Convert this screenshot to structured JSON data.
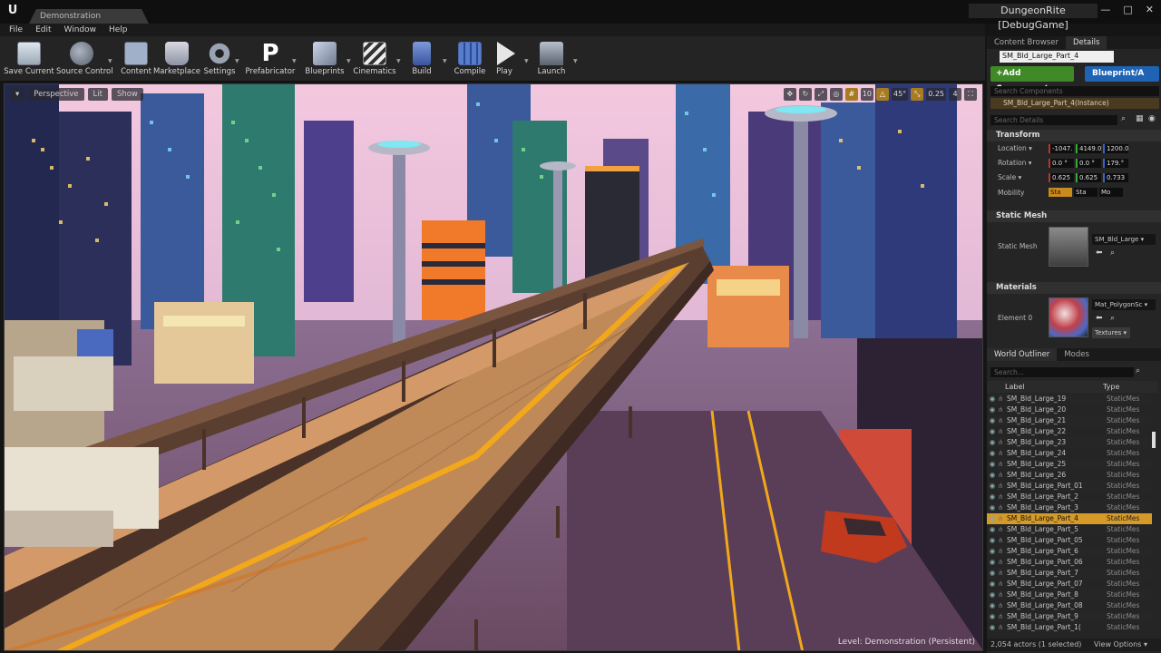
{
  "window": {
    "tab": "Demonstration",
    "project": "DungeonRite [DebugGame]",
    "controls": [
      "—",
      "□",
      "✕"
    ]
  },
  "menu": [
    "File",
    "Edit",
    "Window",
    "Help"
  ],
  "toolbar": {
    "buttons": [
      {
        "label": "Save Current",
        "icon": "save-icon"
      },
      {
        "label": "Source Control",
        "icon": "source-control-icon"
      },
      {
        "label": "Content",
        "icon": "content-icon"
      },
      {
        "label": "Marketplace",
        "icon": "marketplace-icon"
      },
      {
        "label": "Settings",
        "icon": "settings-gear-icon"
      },
      {
        "label": "Prefabricator",
        "icon": "prefabricator-p-icon",
        "glyph": "P"
      },
      {
        "label": "Blueprints",
        "icon": "blueprints-icon"
      },
      {
        "label": "Cinematics",
        "icon": "clapperboard-icon"
      },
      {
        "label": "Build",
        "icon": "build-icon"
      },
      {
        "label": "Compile",
        "icon": "compile-icon"
      },
      {
        "label": "Play",
        "icon": "play-icon"
      },
      {
        "label": "Launch",
        "icon": "launch-icon"
      }
    ]
  },
  "viewport": {
    "mode": "Perspective",
    "lighting": "Lit",
    "show": "Show",
    "snap": [
      "10",
      "45°",
      "0.25",
      "4"
    ],
    "level_label": "Level:  Demonstration (Persistent)"
  },
  "right_panel": {
    "tabs": [
      "Content Browser",
      "Details"
    ],
    "actor_name": "SM_Bld_Large_Part_4",
    "add_component": "+Add Component ▾",
    "blueprint": "Blueprint/A",
    "search_components": "Search Components",
    "component_instance": "SM_Bld_Large_Part_4(Instance)",
    "search_details": "Search Details",
    "transform": {
      "title": "Transform",
      "location_label": "Location ▾",
      "location": [
        "-1047.",
        "4149.0",
        "1200.0"
      ],
      "rotation_label": "Rotation ▾",
      "rotation": [
        "0.0 °",
        "0.0 °",
        "179.°"
      ],
      "scale_label": "Scale ▾",
      "scale": [
        "0.625",
        "0.625",
        "0.733"
      ],
      "mobility_label": "Mobility",
      "mobility_options": [
        "Sta",
        "Sta",
        "Mo"
      ]
    },
    "static_mesh": {
      "title": "Static Mesh",
      "label": "Static Mesh",
      "asset": "SM_Bld_Large ▾"
    },
    "materials": {
      "title": "Materials",
      "element_label": "Element 0",
      "asset": "Mat_PolygonSc ▾",
      "textures": "Textures ▾"
    }
  },
  "outliner": {
    "tabs": [
      "World Outliner",
      "Modes"
    ],
    "search": "Search...",
    "col_label": "Label",
    "col_type": "Type",
    "rows": [
      {
        "label": "SM_Bld_Large_19",
        "type": "StaticMeshA"
      },
      {
        "label": "SM_Bld_Large_20",
        "type": "StaticMeshA"
      },
      {
        "label": "SM_Bld_Large_21",
        "type": "StaticMeshA"
      },
      {
        "label": "SM_Bld_Large_22",
        "type": "StaticMeshA"
      },
      {
        "label": "SM_Bld_Large_23",
        "type": "StaticMeshA"
      },
      {
        "label": "SM_Bld_Large_24",
        "type": "StaticMeshA"
      },
      {
        "label": "SM_Bld_Large_25",
        "type": "StaticMeshA"
      },
      {
        "label": "SM_Bld_Large_26",
        "type": "StaticMeshA"
      },
      {
        "label": "SM_Bld_Large_Part_01",
        "type": "StaticMeshA"
      },
      {
        "label": "SM_Bld_Large_Part_2",
        "type": "StaticMeshA"
      },
      {
        "label": "SM_Bld_Large_Part_3",
        "type": "StaticMeshA"
      },
      {
        "label": "SM_Bld_Large_Part_4",
        "type": "StaticMeshA",
        "selected": true
      },
      {
        "label": "SM_Bld_Large_Part_5",
        "type": "StaticMeshA"
      },
      {
        "label": "SM_Bld_Large_Part_05",
        "type": "StaticMeshA"
      },
      {
        "label": "SM_Bld_Large_Part_6",
        "type": "StaticMeshA"
      },
      {
        "label": "SM_Bld_Large_Part_06",
        "type": "StaticMeshA"
      },
      {
        "label": "SM_Bld_Large_Part_7",
        "type": "StaticMeshA"
      },
      {
        "label": "SM_Bld_Large_Part_07",
        "type": "StaticMeshA"
      },
      {
        "label": "SM_Bld_Large_Part_8",
        "type": "StaticMeshA"
      },
      {
        "label": "SM_Bld_Large_Part_08",
        "type": "StaticMeshA"
      },
      {
        "label": "SM_Bld_Large_Part_9",
        "type": "StaticMeshA"
      },
      {
        "label": "SM_Bld_Large_Part_1(",
        "type": "StaticMeshA"
      }
    ],
    "actor_count": "2,054 actors (1 selected)",
    "view_options": "View Options ▾"
  },
  "colors": {
    "selection": "#d59a27",
    "add_component": "#3f8a26",
    "blueprint": "#1f63b5",
    "sky": "#e8b8d6",
    "road": "#b98550",
    "road_stripe": "#f2a81a"
  }
}
